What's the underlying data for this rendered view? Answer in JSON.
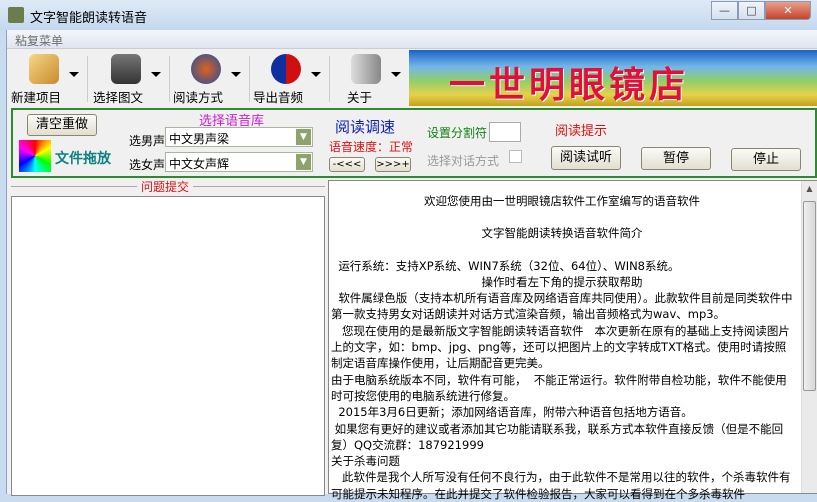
{
  "window": {
    "title": "文字智能朗读转语音",
    "minimize": "—",
    "maximize": "□",
    "close": "✕"
  },
  "menu": {
    "item": "粘复菜单"
  },
  "toolbar": [
    {
      "label": "新建项目",
      "icon": "folder-icon"
    },
    {
      "label": "选择图文",
      "icon": "projector-icon"
    },
    {
      "label": "阅读方式",
      "icon": "globe-surfer-icon"
    },
    {
      "label": "导出音频",
      "icon": "refresh-arrows-icon"
    },
    {
      "label": "关于",
      "icon": "book-cd-icon"
    }
  ],
  "banner": {
    "text": "一世明眼镜店"
  },
  "controls": {
    "clear_button": "清空重做",
    "file_drop": "文件拖放",
    "voice_lib_title": "选择语音库",
    "male_label": "选男声",
    "male_value": "中文男声梁",
    "female_label": "选女声",
    "female_value": "中文女声辉",
    "speed_title": "阅读调速",
    "speed_status": "语音速度：正常",
    "slower": "-<<<",
    "faster": ">>>+",
    "separator_label": "设置分割符",
    "separator_value": "",
    "dialog_label": "选择对话方式",
    "hint_title": "阅读提示",
    "preview_button": "阅读试听",
    "pause_button": "暂停",
    "stop_button": "停止"
  },
  "left_panel": {
    "title": "问题提交"
  },
  "content": {
    "lines": [
      "欢迎您使用由一世明眼镜店软件工作室编写的语音软件",
      "文字智能朗读转换语音软件简介",
      "  运行系统：支持XP系统、WIN7系统（32位、64位）、WIN8系统。",
      "操作时看左下角的提示获取帮助",
      "  软件属绿色版（支持本机所有语音库及网络语音库共同使用）。此款软件目前是同类软件中第一款支持男女对话朗读并对话方式渲染音频，输出音频格式为wav、mp3。",
      "   您现在使用的是最新版文字智能朗读转语音软件   本次更新在原有的基础上支持阅读图片上的文字，如：bmp、jpg、png等，还可以把图片上的文字转成TXT格式。使用时请按照制定语音库操作使用，让后期配音更完美。",
      "由于电脑系统版本不同，软件有可能，  不能正常运行。软件附带自检功能，软件不能使用时可按您使用的电脑系统进行修复。",
      "  2015年3月6日更新；添加网络语音库，附带六种语音包括地方语音。",
      " 如果您有更好的建议或者添加其它功能请联系我，联系方式本软件直接反馈（但是不能回复）QQ交流群：187921999",
      "关于杀毒问题",
      "   此软件是我个人所写没有任何不良行为，由于此软件不是常用以往的软件，个杀毒软件有可能提示未知程序。在此并提交了软件检验报告，大家可以看得到在个多杀毒软件"
    ]
  },
  "colors": {
    "panel_border": "#2f8a2f",
    "red": "#e01010",
    "magenta": "#d020d0",
    "blue": "#1020c0",
    "green": "#108010",
    "teal": "#108080"
  }
}
